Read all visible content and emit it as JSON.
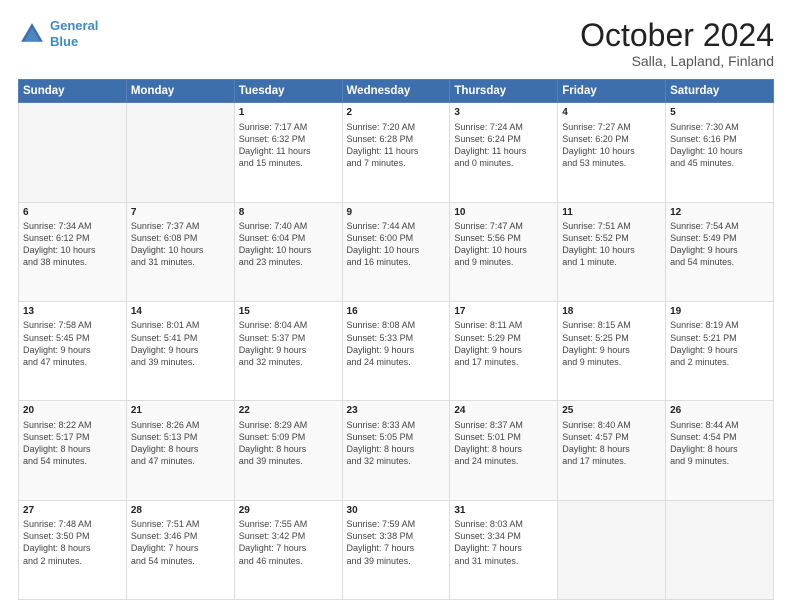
{
  "header": {
    "logo_line1": "General",
    "logo_line2": "Blue",
    "title": "October 2024",
    "subtitle": "Salla, Lapland, Finland"
  },
  "days_header": [
    "Sunday",
    "Monday",
    "Tuesday",
    "Wednesday",
    "Thursday",
    "Friday",
    "Saturday"
  ],
  "weeks": [
    [
      {
        "day": "",
        "info": ""
      },
      {
        "day": "",
        "info": ""
      },
      {
        "day": "1",
        "info": "Sunrise: 7:17 AM\nSunset: 6:32 PM\nDaylight: 11 hours\nand 15 minutes."
      },
      {
        "day": "2",
        "info": "Sunrise: 7:20 AM\nSunset: 6:28 PM\nDaylight: 11 hours\nand 7 minutes."
      },
      {
        "day": "3",
        "info": "Sunrise: 7:24 AM\nSunset: 6:24 PM\nDaylight: 11 hours\nand 0 minutes."
      },
      {
        "day": "4",
        "info": "Sunrise: 7:27 AM\nSunset: 6:20 PM\nDaylight: 10 hours\nand 53 minutes."
      },
      {
        "day": "5",
        "info": "Sunrise: 7:30 AM\nSunset: 6:16 PM\nDaylight: 10 hours\nand 45 minutes."
      }
    ],
    [
      {
        "day": "6",
        "info": "Sunrise: 7:34 AM\nSunset: 6:12 PM\nDaylight: 10 hours\nand 38 minutes."
      },
      {
        "day": "7",
        "info": "Sunrise: 7:37 AM\nSunset: 6:08 PM\nDaylight: 10 hours\nand 31 minutes."
      },
      {
        "day": "8",
        "info": "Sunrise: 7:40 AM\nSunset: 6:04 PM\nDaylight: 10 hours\nand 23 minutes."
      },
      {
        "day": "9",
        "info": "Sunrise: 7:44 AM\nSunset: 6:00 PM\nDaylight: 10 hours\nand 16 minutes."
      },
      {
        "day": "10",
        "info": "Sunrise: 7:47 AM\nSunset: 5:56 PM\nDaylight: 10 hours\nand 9 minutes."
      },
      {
        "day": "11",
        "info": "Sunrise: 7:51 AM\nSunset: 5:52 PM\nDaylight: 10 hours\nand 1 minute."
      },
      {
        "day": "12",
        "info": "Sunrise: 7:54 AM\nSunset: 5:49 PM\nDaylight: 9 hours\nand 54 minutes."
      }
    ],
    [
      {
        "day": "13",
        "info": "Sunrise: 7:58 AM\nSunset: 5:45 PM\nDaylight: 9 hours\nand 47 minutes."
      },
      {
        "day": "14",
        "info": "Sunrise: 8:01 AM\nSunset: 5:41 PM\nDaylight: 9 hours\nand 39 minutes."
      },
      {
        "day": "15",
        "info": "Sunrise: 8:04 AM\nSunset: 5:37 PM\nDaylight: 9 hours\nand 32 minutes."
      },
      {
        "day": "16",
        "info": "Sunrise: 8:08 AM\nSunset: 5:33 PM\nDaylight: 9 hours\nand 24 minutes."
      },
      {
        "day": "17",
        "info": "Sunrise: 8:11 AM\nSunset: 5:29 PM\nDaylight: 9 hours\nand 17 minutes."
      },
      {
        "day": "18",
        "info": "Sunrise: 8:15 AM\nSunset: 5:25 PM\nDaylight: 9 hours\nand 9 minutes."
      },
      {
        "day": "19",
        "info": "Sunrise: 8:19 AM\nSunset: 5:21 PM\nDaylight: 9 hours\nand 2 minutes."
      }
    ],
    [
      {
        "day": "20",
        "info": "Sunrise: 8:22 AM\nSunset: 5:17 PM\nDaylight: 8 hours\nand 54 minutes."
      },
      {
        "day": "21",
        "info": "Sunrise: 8:26 AM\nSunset: 5:13 PM\nDaylight: 8 hours\nand 47 minutes."
      },
      {
        "day": "22",
        "info": "Sunrise: 8:29 AM\nSunset: 5:09 PM\nDaylight: 8 hours\nand 39 minutes."
      },
      {
        "day": "23",
        "info": "Sunrise: 8:33 AM\nSunset: 5:05 PM\nDaylight: 8 hours\nand 32 minutes."
      },
      {
        "day": "24",
        "info": "Sunrise: 8:37 AM\nSunset: 5:01 PM\nDaylight: 8 hours\nand 24 minutes."
      },
      {
        "day": "25",
        "info": "Sunrise: 8:40 AM\nSunset: 4:57 PM\nDaylight: 8 hours\nand 17 minutes."
      },
      {
        "day": "26",
        "info": "Sunrise: 8:44 AM\nSunset: 4:54 PM\nDaylight: 8 hours\nand 9 minutes."
      }
    ],
    [
      {
        "day": "27",
        "info": "Sunrise: 7:48 AM\nSunset: 3:50 PM\nDaylight: 8 hours\nand 2 minutes."
      },
      {
        "day": "28",
        "info": "Sunrise: 7:51 AM\nSunset: 3:46 PM\nDaylight: 7 hours\nand 54 minutes."
      },
      {
        "day": "29",
        "info": "Sunrise: 7:55 AM\nSunset: 3:42 PM\nDaylight: 7 hours\nand 46 minutes."
      },
      {
        "day": "30",
        "info": "Sunrise: 7:59 AM\nSunset: 3:38 PM\nDaylight: 7 hours\nand 39 minutes."
      },
      {
        "day": "31",
        "info": "Sunrise: 8:03 AM\nSunset: 3:34 PM\nDaylight: 7 hours\nand 31 minutes."
      },
      {
        "day": "",
        "info": ""
      },
      {
        "day": "",
        "info": ""
      }
    ]
  ]
}
